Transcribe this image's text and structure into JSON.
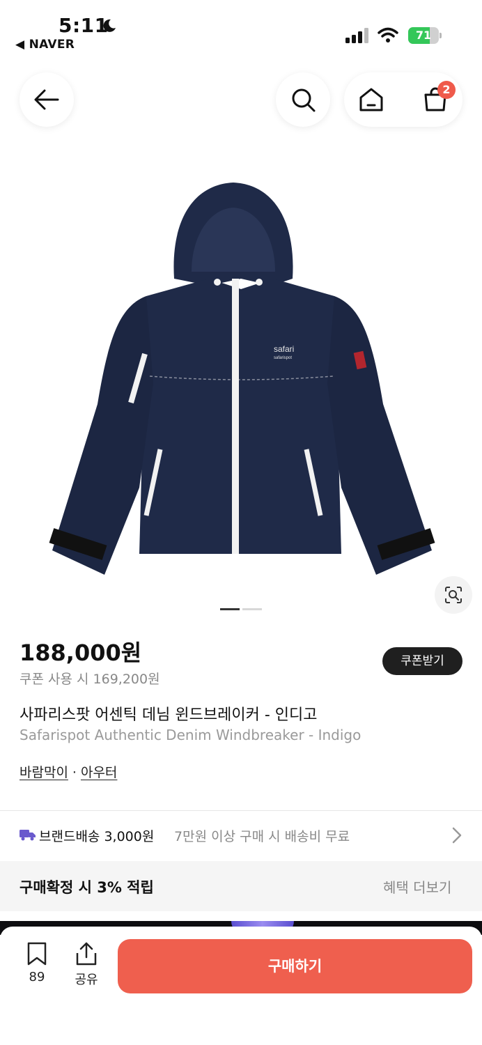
{
  "status_bar": {
    "time": "5:11",
    "back_app": "◀ NAVER",
    "battery": "71",
    "battery_level": 0.71
  },
  "nav": {
    "cart_count": "2"
  },
  "product": {
    "price": "188,000원",
    "coupon_price": "쿠폰 사용 시 169,200원",
    "coupon_button": "쿠폰받기",
    "title_ko": "사파리스팟 어센틱 데님 윈드브레이커 - 인디고",
    "title_en": "Safarispot Authentic Denim Windbreaker - Indigo",
    "category_1": "바람막이",
    "category_sep": "·",
    "category_2": "아우터",
    "chest_logo": "safari",
    "chest_logo_sub": "safarispot",
    "image_count": 2,
    "image_index": 1
  },
  "shipping": {
    "label": "브랜드배송 3,000원",
    "sub": "7만원 이상 구매 시 배송비 무료"
  },
  "benefit": {
    "text": "구매확정 시 3% 적립",
    "more": "혜택 더보기"
  },
  "bottom_bar": {
    "bookmark_count": "89",
    "share_label": "공유",
    "buy_label": "구매하기"
  },
  "colors": {
    "accent": "#ef5f4e",
    "badge": "#ef5a4b",
    "battery": "#34c759",
    "denim": "#1f2a48"
  }
}
